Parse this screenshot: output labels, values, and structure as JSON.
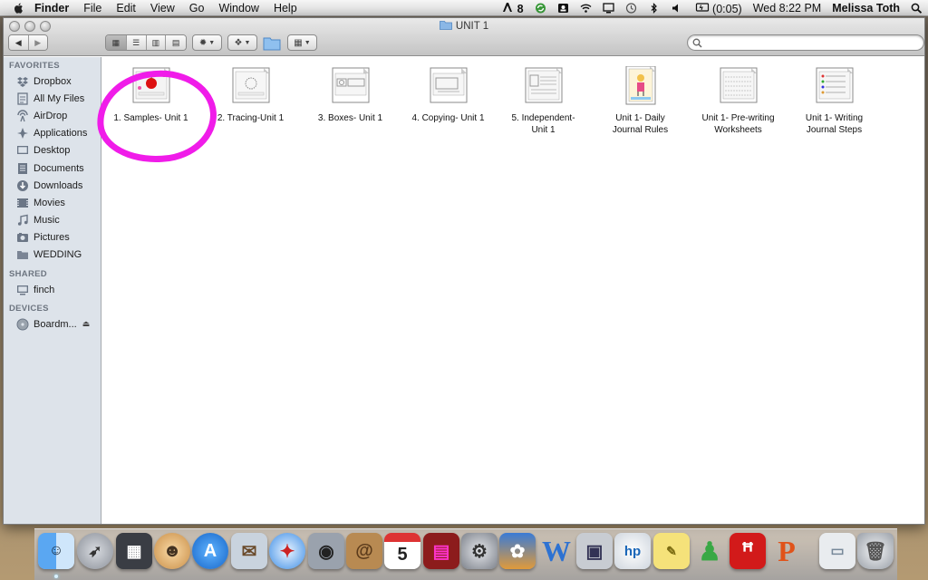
{
  "menubar": {
    "app_name": "Finder",
    "items": [
      "File",
      "Edit",
      "View",
      "Go",
      "Window",
      "Help"
    ],
    "status": {
      "adobe_badge": "8",
      "battery": "(0:05)",
      "clock": "Wed 8:22 PM",
      "user": "Melissa Toth"
    }
  },
  "window": {
    "title": "UNIT 1",
    "search_placeholder": ""
  },
  "sidebar": {
    "favorites_header": "FAVORITES",
    "favorites": [
      {
        "label": "Dropbox",
        "icon": "dropbox-icon"
      },
      {
        "label": "All My Files",
        "icon": "all-files-icon"
      },
      {
        "label": "AirDrop",
        "icon": "airdrop-icon"
      },
      {
        "label": "Applications",
        "icon": "applications-icon"
      },
      {
        "label": "Desktop",
        "icon": "desktop-icon"
      },
      {
        "label": "Documents",
        "icon": "documents-icon"
      },
      {
        "label": "Downloads",
        "icon": "downloads-icon"
      },
      {
        "label": "Movies",
        "icon": "movies-icon"
      },
      {
        "label": "Music",
        "icon": "music-icon"
      },
      {
        "label": "Pictures",
        "icon": "pictures-icon"
      },
      {
        "label": "WEDDING",
        "icon": "folder-icon"
      }
    ],
    "shared_header": "SHARED",
    "shared": [
      {
        "label": "finch",
        "icon": "computer-icon"
      }
    ],
    "devices_header": "DEVICES",
    "devices": [
      {
        "label": "Boardm...",
        "icon": "disk-icon"
      }
    ]
  },
  "files": [
    {
      "line1": "1.  Samples- Unit 1",
      "line2": "",
      "highlighted": true
    },
    {
      "line1": "2.  Tracing-Unit 1",
      "line2": ""
    },
    {
      "line1": "3.  Boxes- Unit 1",
      "line2": ""
    },
    {
      "line1": "4.  Copying- Unit 1",
      "line2": ""
    },
    {
      "line1": "5.  Independent-",
      "line2": "Unit 1"
    },
    {
      "line1": "Unit 1- Daily",
      "line2": "Journal Rules"
    },
    {
      "line1": "Unit 1- Pre-writing",
      "line2": "Worksheets"
    },
    {
      "line1": "Unit 1- Writing",
      "line2": "Journal Steps"
    }
  ],
  "dock": {
    "calendar_day": "5",
    "items": [
      "finder",
      "launchpad",
      "photo-booth",
      "face-app",
      "app-store",
      "mail",
      "safari",
      "facetime",
      "address-book",
      "calendar",
      "photo-slideshow",
      "system-preferences",
      "iphoto",
      "word",
      "preview",
      "hp-utility",
      "stickies",
      "messenger",
      "acrobat",
      "powerpoint",
      "window-preview",
      "trash"
    ],
    "colors": {
      "finder": "#3b7fd9",
      "app_store": "#2a8be8",
      "word": "#2d72d2",
      "acrobat": "#d21a1a",
      "powerpoint": "#e0531a",
      "highlight": "#f01ce9"
    }
  }
}
